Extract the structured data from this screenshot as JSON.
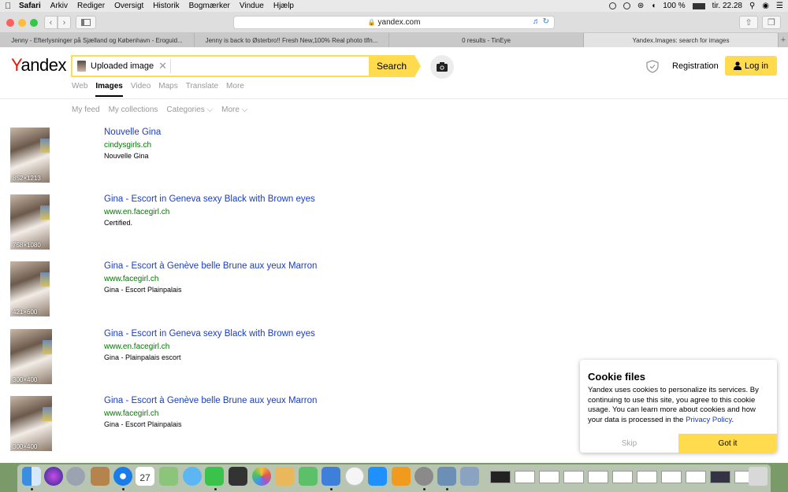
{
  "menubar": {
    "app_name": "Safari",
    "items": [
      "Arkiv",
      "Rediger",
      "Oversigt",
      "Historik",
      "Bogmærker",
      "Vindue",
      "Hjælp"
    ],
    "battery": "100 %",
    "clock": "tir. 22.28"
  },
  "browser": {
    "address": "yandex.com",
    "tabs": [
      {
        "title": "Jenny - Efterlysninger på Sjælland og København - Eroguid...",
        "active": false
      },
      {
        "title": "Jenny is back to Østerbro!! Fresh New,100% Real photo tlfn...",
        "active": false
      },
      {
        "title": "0 results - TinEye",
        "active": false
      },
      {
        "title": "Yandex.Images: search for images",
        "active": true
      }
    ]
  },
  "header": {
    "logo_first": "Y",
    "logo_rest": "andex",
    "search_query": "Uploaded image",
    "search_button": "Search",
    "registration": "Registration",
    "login": "Log in"
  },
  "services": [
    "Web",
    "Images",
    "Video",
    "Maps",
    "Translate",
    "More"
  ],
  "active_service": "Images",
  "subnav": [
    "My feed",
    "My collections",
    "Categories ⌵",
    "More ⌵"
  ],
  "results": [
    {
      "size": "852×1213",
      "title": "Nouvelle Gina",
      "url": "cindysgirls.ch",
      "desc": "Nouvelle Gina"
    },
    {
      "size": "758×1080",
      "title": "Gina - Escort in Geneva sexy Black with Brown eyes",
      "url": "www.en.facegirl.ch",
      "desc": "Certified."
    },
    {
      "size": "421×600",
      "title": "Gina - Escort à Genève belle Brune aux yeux Marron",
      "url": "www.facegirl.ch",
      "desc": "Gina - Escort Plainpalais"
    },
    {
      "size": "300×400",
      "title": "Gina - Escort in Geneva sexy Black with Brown eyes",
      "url": "www.en.facegirl.ch",
      "desc": "Gina - Plainpalais escort"
    },
    {
      "size": "300×400",
      "title": "Gina - Escort à Genève belle Brune aux yeux Marron",
      "url": "www.facegirl.ch",
      "desc": "Gina - Escort Plainpalais"
    }
  ],
  "cookie": {
    "title": "Cookie files",
    "text": "Yandex uses cookies to personalize its services. By continuing to use this site, you agree to this cookie usage. You can learn more about cookies and how your data is processed in the ",
    "link": "Privacy Policy",
    "text_end": ".",
    "skip": "Skip",
    "ok": "Got it"
  },
  "colors": {
    "brand_yellow": "#ffdb4d",
    "link_blue": "#1a3dc1",
    "url_green": "#007700",
    "logo_red": "#e61400"
  },
  "dock": {
    "calendar_day": "27"
  }
}
